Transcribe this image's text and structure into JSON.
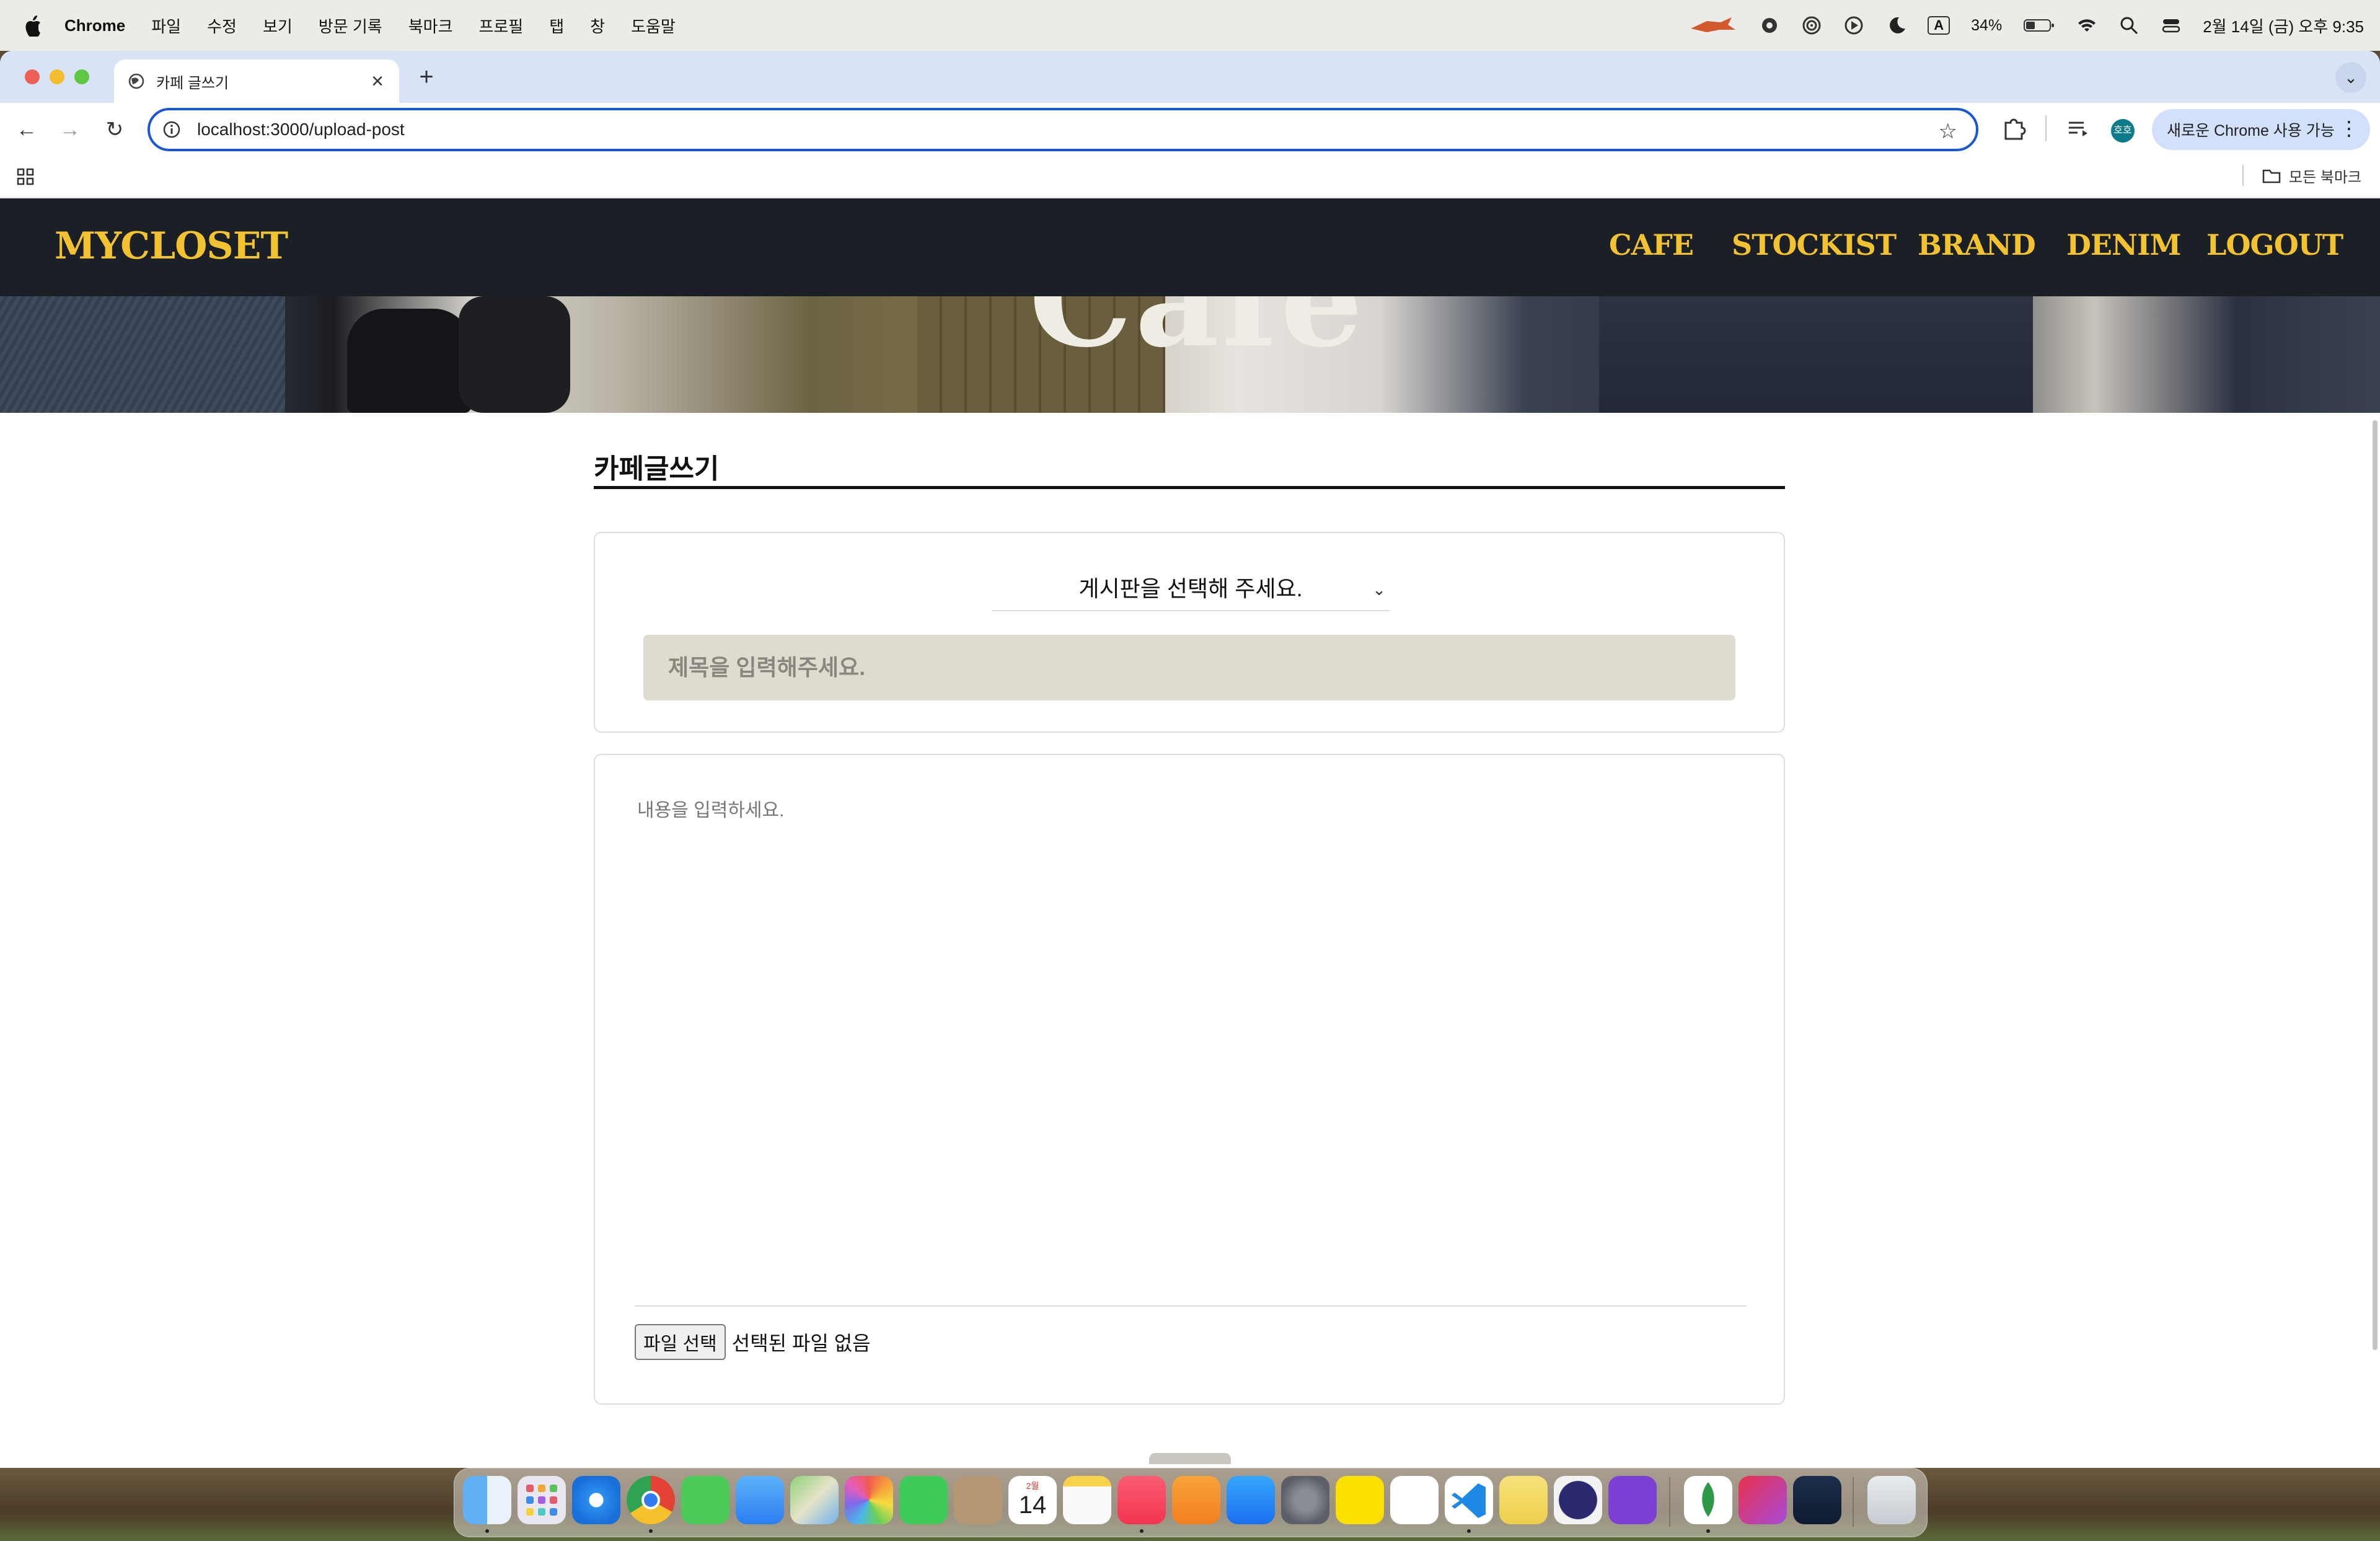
{
  "menubar": {
    "app": "Chrome",
    "items": [
      "파일",
      "수정",
      "보기",
      "방문 기록",
      "북마크",
      "프로필",
      "탭",
      "창",
      "도움말"
    ],
    "battery": "34%",
    "input_source": "A",
    "datetime": "2월 14일 (금) 오후 9:35"
  },
  "browser": {
    "tab_title": "카페 글쓰기",
    "url": "localhost:3000/upload-post",
    "profile_initials": "호호",
    "new_chrome_label": "새로운 Chrome 사용 가능",
    "all_bookmarks": "모든 북마크"
  },
  "site": {
    "logo": "MYCLOSET",
    "nav": [
      "CAFE",
      "STOCKIST",
      "BRAND",
      "DENIM",
      "LOGOUT"
    ],
    "hero_word": "Cafe",
    "page_title": "카페글쓰기",
    "board_select": "게시판을 선택해 주세요.",
    "title_placeholder": "제목을 입력해주세요.",
    "content_placeholder": "내용을 입력하세요.",
    "file_button": "파일 선택",
    "file_status": "선택된 파일 없음"
  },
  "dock": {
    "calendar_month": "2월",
    "calendar_day": "14",
    "apps": [
      "finder-icon",
      "launchpad-icon",
      "safari-icon",
      "chrome-icon",
      "messages-icon",
      "mail-icon",
      "maps-icon",
      "photos-icon",
      "facetime-icon",
      "contacts-icon",
      "calendar-icon",
      "notes-icon",
      "music-icon",
      "pages-icon",
      "app-store-icon",
      "system-settings-icon",
      "kakaotalk-icon",
      "chatgpt-icon",
      "vscode-icon",
      "stickies-icon",
      "eclipse-icon",
      "github-icon",
      "mongodb-icon",
      "creative-cloud-icon",
      "bluesky-icon",
      "trash-icon"
    ]
  },
  "colors": {
    "header_bg": "#1b1f26",
    "nav_accent": "#f2c230",
    "title_input_bg": "#e0dbd0",
    "omnibox_border": "#1a57d4"
  }
}
